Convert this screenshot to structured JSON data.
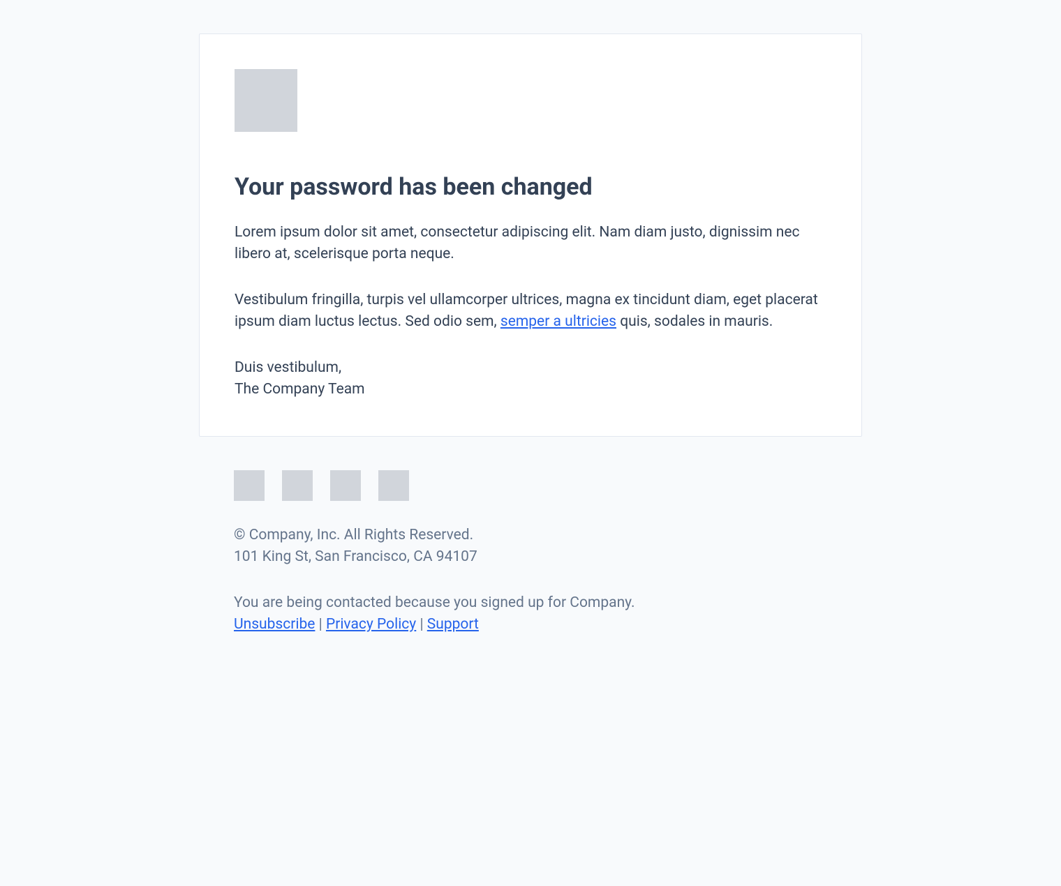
{
  "email": {
    "heading": "Your password has been changed",
    "paragraph1": "Lorem ipsum dolor sit amet, consectetur adipiscing elit. Nam diam justo, dignissim nec libero at, scelerisque porta neque.",
    "paragraph2_pre": "Vestibulum fringilla, turpis vel ullamcorper ultrices, magna ex tincidunt diam, eget placerat ipsum diam luctus lectus. Sed odio sem, ",
    "paragraph2_link": "semper a ultricies",
    "paragraph2_post": " quis, sodales in mauris.",
    "signoff_line1": "Duis vestibulum,",
    "signoff_line2": "The Company Team"
  },
  "footer": {
    "copyright": "© Company, Inc. All Rights Reserved.",
    "address": "101 King St, San Francisco, CA 94107",
    "contact_reason": "You are being contacted because you signed up for Company.",
    "links": {
      "unsubscribe": "Unsubscribe",
      "privacy": "Privacy Policy",
      "support": "Support"
    },
    "separator": " | "
  }
}
